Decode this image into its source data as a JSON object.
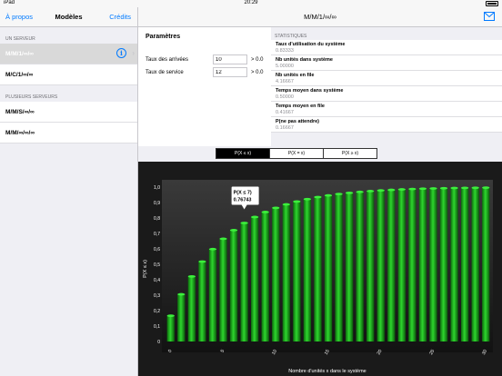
{
  "status": {
    "carrier": "iPad",
    "time": "20:29"
  },
  "master": {
    "nav": {
      "back": "À propos",
      "title": "Modèles",
      "right": "Crédits"
    },
    "sections": [
      {
        "header": "UN SERVEUR",
        "items": [
          "M/M/1/∞/∞",
          "M/C/1/∞/∞"
        ]
      },
      {
        "header": "PLUSIEURS SERVEURS",
        "items": [
          "M/M/S/∞/∞",
          "M/M/∞/∞/∞"
        ]
      }
    ]
  },
  "detail": {
    "title": "M/M/1/∞/∞",
    "params": {
      "heading": "Paramètres",
      "rows": [
        {
          "label": "Taux des arrivées",
          "value": "10",
          "cond": "> 0.0"
        },
        {
          "label": "Taux de service",
          "value": "12",
          "cond": "> 0.0"
        }
      ]
    },
    "stats": {
      "header": "STATISTIQUES",
      "rows": [
        {
          "title": "Taux d'utilisation du système",
          "value": "0.83333"
        },
        {
          "title": "Nb unités dans système",
          "value": "5.00000"
        },
        {
          "title": "Nb unités en file",
          "value": "4.16667"
        },
        {
          "title": "Temps moyen dans système",
          "value": "0.50000"
        },
        {
          "title": "Temps moyen en file",
          "value": "0.41667"
        },
        {
          "title": "P(ne pas attendre)",
          "value": "0.16667"
        }
      ]
    },
    "segments": [
      "P(X ≤ x)",
      "P(X = x)",
      "P(X ≥ x)"
    ],
    "active_segment": 0
  },
  "colors": {
    "accent": "#007aff",
    "bar": "#22c822",
    "chart_bg": "#1a1a1a"
  },
  "chart_data": {
    "type": "bar",
    "xlabel": "Nombre d'unités x dans le système",
    "ylabel": "P(X ≤ x)",
    "x": [
      0,
      1,
      2,
      3,
      4,
      5,
      6,
      7,
      8,
      9,
      10,
      11,
      12,
      13,
      14,
      15,
      16,
      17,
      18,
      19,
      20,
      21,
      22,
      23,
      24,
      25,
      26,
      27,
      28,
      29,
      30
    ],
    "values": [
      0.16667,
      0.30556,
      0.4213,
      0.51775,
      0.59812,
      0.6651,
      0.72092,
      0.76743,
      0.80619,
      0.83849,
      0.86541,
      0.88784,
      0.90654,
      0.92211,
      0.93509,
      0.94591,
      0.95493,
      0.96244,
      0.9687,
      0.97392,
      0.97827,
      0.98189,
      0.98491,
      0.98742,
      0.98952,
      0.99127,
      0.99272,
      0.99394,
      0.99495,
      0.99579,
      0.99649
    ],
    "xticks": [
      "0",
      "5",
      "10",
      "15",
      "20",
      "25",
      "30"
    ],
    "yticks": [
      "0",
      "0,1",
      "0,2",
      "0,3",
      "0,4",
      "0,5",
      "0,6",
      "0,7",
      "0,8",
      "0,9",
      "1,0"
    ],
    "ylim": [
      0,
      1
    ],
    "annotation": {
      "label": "P(X ≤ 7)",
      "value": "0.76743",
      "x": 7
    }
  }
}
